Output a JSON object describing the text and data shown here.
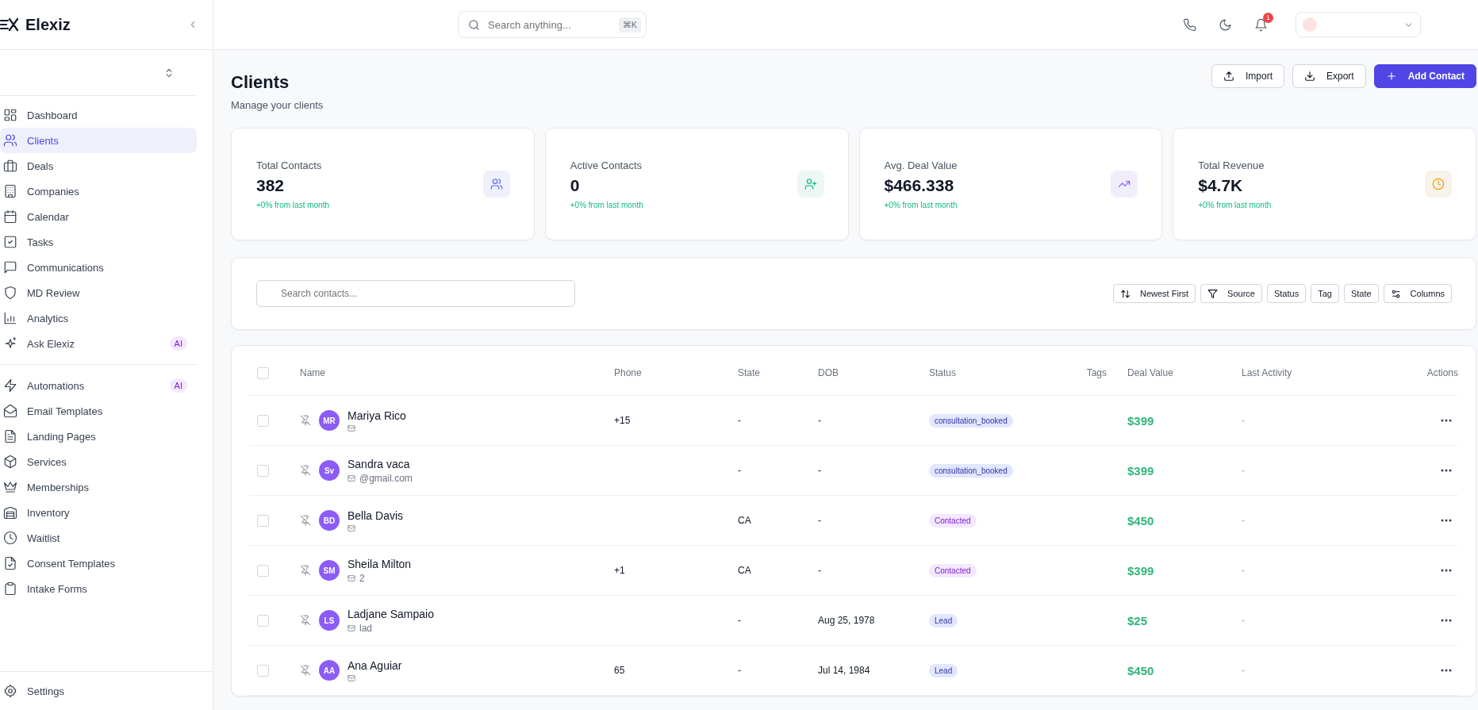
{
  "sidebar": {
    "brand": "Elexiz",
    "nav_groups": [
      [
        {
          "label": "Dashboard",
          "selected": false
        },
        {
          "label": "Clients",
          "selected": true
        },
        {
          "label": "Deals",
          "selected": false
        },
        {
          "label": "Companies",
          "selected": false
        },
        {
          "label": "Calendar",
          "selected": false
        },
        {
          "label": "Tasks",
          "selected": false
        },
        {
          "label": "Communications",
          "selected": false
        },
        {
          "label": "MD Review",
          "selected": false
        },
        {
          "label": "Analytics",
          "selected": false
        },
        {
          "label": "Ask Elexiz",
          "selected": false,
          "badge": "AI"
        }
      ],
      [
        {
          "label": "Automations",
          "selected": false,
          "badge": "AI"
        },
        {
          "label": "Email Templates",
          "selected": false
        },
        {
          "label": "Landing Pages",
          "selected": false
        },
        {
          "label": "Services",
          "selected": false
        },
        {
          "label": "Memberships",
          "selected": false
        },
        {
          "label": "Inventory",
          "selected": false
        },
        {
          "label": "Waitlist",
          "selected": false
        },
        {
          "label": "Consent Templates",
          "selected": false
        },
        {
          "label": "Intake Forms",
          "selected": false
        }
      ]
    ],
    "footer_item": "Settings"
  },
  "topbar": {
    "search_placeholder": "Search anything...",
    "shortcut": "⌘K",
    "notification_count": "1"
  },
  "page": {
    "title": "Clients",
    "subtitle": "Manage your clients",
    "buttons": [
      "Import",
      "Export",
      "Add Contact"
    ]
  },
  "stats": [
    {
      "label": "Total Contacts",
      "value": "382",
      "change": "+0% from last month"
    },
    {
      "label": "Active Contacts",
      "value": "0",
      "change": "+0% from last month"
    },
    {
      "label": "Avg. Deal Value",
      "value": "$466.338",
      "change": "+0% from last month"
    },
    {
      "label": "Total Revenue",
      "value": "$4.7K",
      "change": "+0% from last month"
    }
  ],
  "filters": {
    "search_placeholder": "Search contacts...",
    "buttons": [
      "Newest First",
      "Source",
      "Status",
      "Tag",
      "State",
      "Columns"
    ]
  },
  "table": {
    "select_all_checked": false,
    "columns": [
      "Name",
      "Phone",
      "State",
      "DOB",
      "Status",
      "Tags",
      "Deal Value",
      "Last Activity",
      "Actions"
    ],
    "rows": [
      {
        "checked": false,
        "initials": "MR",
        "name": "Mariya Rico",
        "email": "",
        "phone": "+15",
        "state": "-",
        "dob": "-",
        "status": {
          "label": "consultation_booked",
          "color": "#e0e7ff"
        },
        "deal_value": "$399",
        "last_activity": "-"
      },
      {
        "checked": false,
        "initials": "Sv",
        "name": "Sandra vaca",
        "email": "@gmail.com",
        "phone": "",
        "state": "-",
        "dob": "-",
        "status": {
          "label": "consultation_booked",
          "color": "#e0e7ff"
        },
        "deal_value": "$399",
        "last_activity": "-"
      },
      {
        "checked": false,
        "initials": "BD",
        "name": "Bella Davis",
        "email": "",
        "phone": "",
        "state": "CA",
        "dob": "-",
        "status": {
          "label": "Contacted",
          "color": "#f3e8ff"
        },
        "deal_value": "$450",
        "last_activity": "-"
      },
      {
        "checked": false,
        "initials": "SM",
        "name": "Sheila Milton",
        "email": "2",
        "phone": "+1",
        "state": "CA",
        "dob": "-",
        "status": {
          "label": "Contacted",
          "color": "#f3e8ff"
        },
        "deal_value": "$399",
        "last_activity": "-"
      },
      {
        "checked": false,
        "initials": "LS",
        "name": "Ladjane Sampaio",
        "email": "lad",
        "phone": "",
        "state": "-",
        "dob": "Aug 25, 1978",
        "status": {
          "label": "Lead",
          "color": "#e0e7ff"
        },
        "deal_value": "$25",
        "last_activity": "-"
      },
      {
        "checked": false,
        "initials": "AA",
        "name": "Ana Aguiar",
        "email": "",
        "phone": "65",
        "state": "-",
        "dob": "Jul 14, 1984",
        "status": {
          "label": "Lead",
          "color": "#e0e7ff"
        },
        "deal_value": "$450",
        "last_activity": "-"
      }
    ]
  }
}
